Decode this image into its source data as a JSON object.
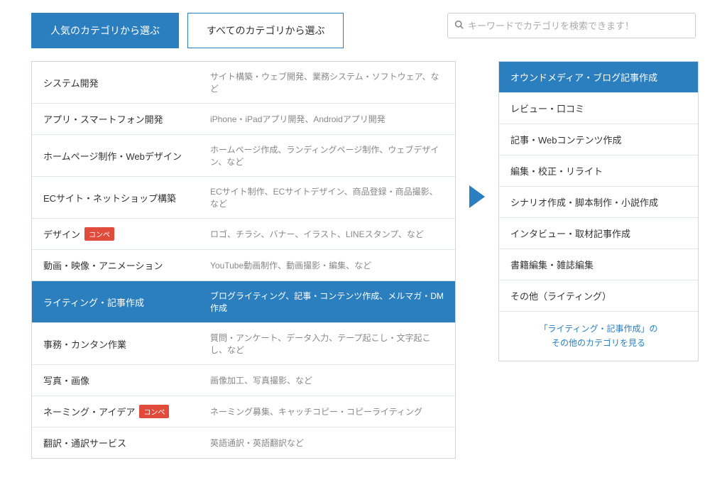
{
  "tabs": {
    "popular": "人気のカテゴリから選ぶ",
    "all": "すべてのカテゴリから選ぶ"
  },
  "search": {
    "placeholder": "キーワードでカテゴリを検索できます！"
  },
  "badge_label": "コンペ",
  "categories": [
    {
      "title": "システム開発",
      "desc": "サイト構築・ウェブ開発、業務システム・ソフトウェア、など",
      "badge": false,
      "selected": false
    },
    {
      "title": "アプリ・スマートフォン開発",
      "desc": "iPhone・iPadアプリ開発、Androidアプリ開発",
      "badge": false,
      "selected": false
    },
    {
      "title": "ホームページ制作・Webデザイン",
      "desc": "ホームページ作成、ランディングページ制作、ウェブデザイン、など",
      "badge": false,
      "selected": false
    },
    {
      "title": "ECサイト・ネットショップ構築",
      "desc": "ECサイト制作、ECサイトデザイン、商品登録・商品撮影、など",
      "badge": false,
      "selected": false
    },
    {
      "title": "デザイン",
      "desc": "ロゴ、チラシ、バナー、イラスト、LINEスタンプ、など",
      "badge": true,
      "selected": false
    },
    {
      "title": "動画・映像・アニメーション",
      "desc": "YouTube動画制作、動画撮影・編集、など",
      "badge": false,
      "selected": false
    },
    {
      "title": "ライティング・記事作成",
      "desc": "ブログライティング、記事・コンテンツ作成、メルマガ・DM作成",
      "badge": false,
      "selected": true
    },
    {
      "title": "事務・カンタン作業",
      "desc": "質問・アンケート、データ入力、テープ起こし・文字起こし、など",
      "badge": false,
      "selected": false
    },
    {
      "title": "写真・画像",
      "desc": "画像加工、写真撮影、など",
      "badge": false,
      "selected": false
    },
    {
      "title": "ネーミング・アイデア",
      "desc": "ネーミング募集、キャッチコピー・コピーライティング",
      "badge": true,
      "selected": false
    },
    {
      "title": "翻訳・通訳サービス",
      "desc": "英語通訳・英語翻訳など",
      "badge": false,
      "selected": false
    }
  ],
  "sub_header": "オウンドメディア・ブログ記事作成",
  "sub_items": [
    "レビュー・口コミ",
    "記事・Webコンテンツ作成",
    "編集・校正・リライト",
    "シナリオ作成・脚本制作・小説作成",
    "インタビュー・取材記事作成",
    "書籍編集・雑誌編集",
    "その他（ライティング）"
  ],
  "sub_footer_line1": "「ライティング・記事作成」の",
  "sub_footer_line2": "その他のカテゴリを見る",
  "colors": {
    "primary": "#2c7fbf",
    "badge": "#e14b3b"
  }
}
